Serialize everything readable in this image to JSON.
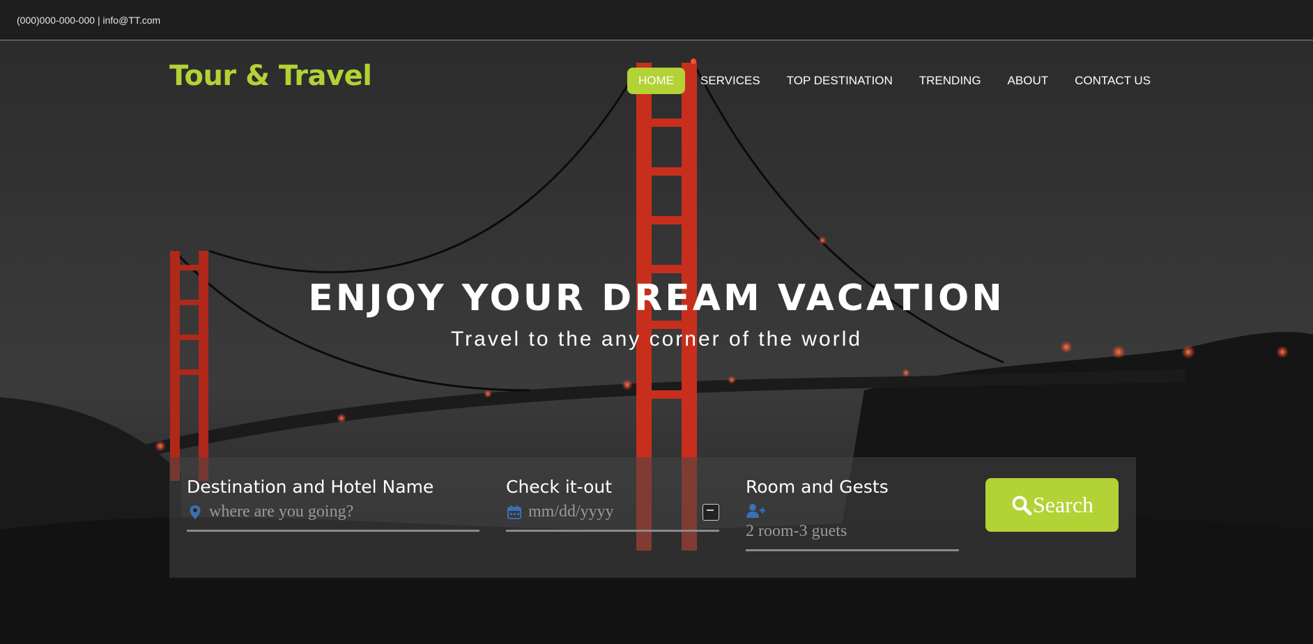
{
  "topbar": {
    "contact": "(000)000-000-000 | info@TT.com"
  },
  "brand": {
    "logo": "Tour & Travel",
    "accent": "#b3d235"
  },
  "nav": {
    "items": [
      "HOME",
      "SERVICES",
      "TOP DESTINATION",
      "TRENDING",
      "ABOUT",
      "CONTACT US"
    ],
    "active": "HOME"
  },
  "hero": {
    "title": "ENJOY YOUR DREAM VACATION",
    "subtitle": "Travel to the any corner of the world"
  },
  "search": {
    "destination": {
      "label": "Destination and Hotel Name",
      "placeholder": "where are you going?",
      "icon": "map-pin-icon"
    },
    "checkout": {
      "label": "Check it-out",
      "placeholder": "mm/dd/yyyy",
      "icon": "calendar-icon"
    },
    "rooms": {
      "label": "Room and Gests",
      "placeholder": "2 room-3 guets",
      "icon": "add-user-icon"
    },
    "button": {
      "label": "Search",
      "icon": "search-icon"
    }
  },
  "colors": {
    "accent": "#b3d235",
    "icon_blue": "#3b6fb6",
    "bridge_red": "#e0361f"
  }
}
